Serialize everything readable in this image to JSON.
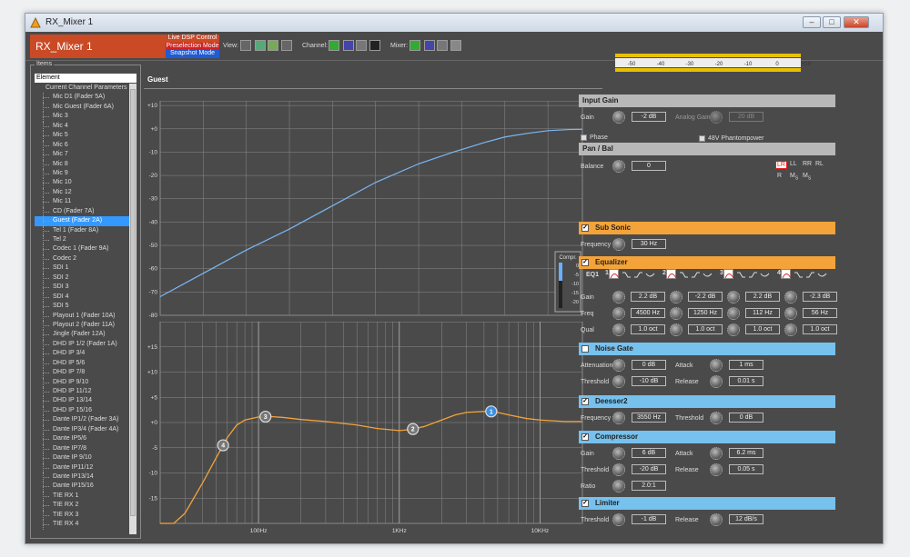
{
  "window": {
    "title": "RX_Mixer 1"
  },
  "toolbar": {
    "app_name": "RX_Mixer 1",
    "modes": [
      {
        "label": "Live DSP Control",
        "color": "#c94a25"
      },
      {
        "label": "Preselection Mode",
        "color": "#d31f1f"
      },
      {
        "label": "Snapshot Mode",
        "color": "#1f5bd3"
      }
    ],
    "view_label": "View:",
    "channel_label": "Channel:",
    "mixer_label": "Mixer:"
  },
  "items_panel": {
    "legend": "Items",
    "column_header": "Element",
    "items": [
      "Current Channel Parameters",
      "Mic      D1 (Fader 5A)",
      "Mic      Guest (Fader 6A)",
      "Mic 3",
      "Mic 4",
      "Mic 5",
      "Mic 6",
      "Mic 7",
      "Mic 8",
      "Mic 9",
      "Mic 10",
      "Mic 12",
      "Mic 11",
      "CD (Fader 7A)",
      "Guest (Fader 2A)",
      "Tel 1 (Fader 8A)",
      "Tel 2",
      "Codec 1 (Fader 9A)",
      "Codec 2",
      "SDI 1",
      "SDI 2",
      "SDI 3",
      "SDI 4",
      "SDI 5",
      "Playout 1 (Fader 10A)",
      "Playout 2 (Fader 11A)",
      "Jingle (Fader 12A)",
      "DHD IP  1/2 (Fader 1A)",
      "DHD IP  3/4",
      "DHD IP  5/6",
      "DHD IP  7/8",
      "DHD IP  9/10",
      "DHD IP  11/12",
      "DHD IP  13/14",
      "DHD IP  15/16",
      "Dante IP1/2 (Fader 3A)",
      "Dante IP3/4 (Fader 4A)",
      "Dante IP5/6",
      "Dante IP7/8",
      "Dante IP 9/10",
      "Dante IP11/12",
      "Dante IP13/14",
      "Dante IP15/16",
      "TIE RX 1",
      "TIE RX 2",
      "TIE RX 3",
      "TIE RX 4"
    ],
    "selected_index": 14
  },
  "channel_title": "Guest",
  "meter": {
    "ticks": [
      "-50",
      "-40",
      "-30",
      "-20",
      "-10",
      "0",
      "+10"
    ],
    "ovl_label": "OVL"
  },
  "dynamics_chart": {
    "x_ticks": [
      "-80",
      "-70",
      "-60",
      "-50",
      "-40",
      "-30",
      "-20",
      "-10",
      "+0",
      "+10"
    ],
    "y_ticks": [
      "+10",
      "+0",
      "-10",
      "-20",
      "-30",
      "-40",
      "-50",
      "-60",
      "-70",
      "-80"
    ],
    "compr_label": "Compr.",
    "compr_ticks": [
      "0",
      "-5",
      "-10",
      "-15",
      "-20"
    ]
  },
  "eq_chart": {
    "y_ticks": [
      "+15",
      "+10",
      "+5",
      "+0",
      "-5",
      "-10",
      "-15"
    ],
    "x_labels": [
      "100Hz",
      "1KHz",
      "10KHz"
    ],
    "band_markers": [
      "1",
      "2",
      "3",
      "4"
    ]
  },
  "chart_data": [
    {
      "type": "line",
      "title": "",
      "xlabel": "",
      "ylabel": "",
      "xlim": [
        -80,
        18
      ],
      "ylim": [
        -80,
        12
      ],
      "series": [
        {
          "values_x": [
            -80,
            -70,
            -60,
            -50,
            -40,
            -30,
            -20,
            -12,
            -5,
            0,
            5,
            10,
            15,
            18
          ],
          "values_y": [
            -72,
            -62,
            -52,
            -43,
            -33,
            -23,
            -15,
            -10,
            -6,
            -3.5,
            -2,
            -0.8,
            -0.3,
            -0.2
          ]
        }
      ]
    },
    {
      "type": "line",
      "title": "",
      "xlabel": "",
      "ylabel": "",
      "xlim": [
        20,
        20000
      ],
      "ylim": [
        -20,
        20
      ],
      "xscale": "log",
      "series": [
        {
          "values_x": [
            20,
            25,
            30,
            40,
            50,
            60,
            70,
            80,
            100,
            120,
            150,
            200,
            300,
            500,
            700,
            1000,
            1200,
            1500,
            2000,
            2500,
            3000,
            4000,
            4500,
            5000,
            6000,
            8000,
            10000,
            15000,
            20000
          ],
          "values_y": [
            -20,
            -20,
            -18,
            -12,
            -7,
            -3,
            -0.5,
            0.5,
            1.1,
            1.2,
            1,
            0.6,
            0.2,
            -0.5,
            -1.2,
            -1.6,
            -1.4,
            -0.8,
            0.5,
            1.5,
            2,
            2.2,
            2.2,
            2,
            1.5,
            0.8,
            0.5,
            0.2,
            0.2
          ]
        }
      ],
      "markers": [
        {
          "band": "1",
          "freq": 4500,
          "gain": 2.2
        },
        {
          "band": "2",
          "freq": 1250,
          "gain": -2.2
        },
        {
          "band": "3",
          "freq": 112,
          "gain": 2.2
        },
        {
          "band": "4",
          "freq": 56,
          "gain": -2.3
        }
      ]
    }
  ],
  "input_gain": {
    "title": "Input Gain",
    "gain_label": "Gain",
    "gain": "-2 dB",
    "analog_label": "Analog Gain",
    "analog": "20 dB",
    "phase_label": "Phase",
    "phantom_label": "48V Phantompower"
  },
  "pan_bal": {
    "title": "Pan / Bal",
    "balance_label": "Balance",
    "balance": "0",
    "modes_row1": [
      "LR",
      "LL",
      "RR",
      "RL"
    ],
    "modes_row2": [
      "R",
      "M",
      "M"
    ],
    "modes_row2_sub": [
      "",
      "S",
      "S"
    ]
  },
  "sub_sonic": {
    "title": "Sub Sonic",
    "freq_label": "Frequency",
    "freq": "30 Hz"
  },
  "equalizer": {
    "title": "Equalizer",
    "eq_label": "EQ1",
    "bands": [
      "1",
      "2",
      "3",
      "4"
    ],
    "gain_label": "Gain",
    "freq_label": "Freq",
    "qual_label": "Qual",
    "gains": [
      "2.2 dB",
      "-2.2 dB",
      "2.2 dB",
      "-2.3 dB"
    ],
    "freqs": [
      "4500 Hz",
      "1250 Hz",
      "112 Hz",
      "56 Hz"
    ],
    "quals": [
      "1.0 oct",
      "1.0 oct",
      "1.0 oct",
      "1.0 oct"
    ]
  },
  "noise_gate": {
    "title": "Noise Gate",
    "att_label": "Attenuation",
    "att": "0 dB",
    "thr_label": "Threshold",
    "thr": "-10 dB",
    "attack_label": "Attack",
    "attack": "1 ms",
    "release_label": "Release",
    "release": "0.01 s"
  },
  "deesser": {
    "title": "Deesser2",
    "freq_label": "Frequency",
    "freq": "3550 Hz",
    "thr_label": "Threshold",
    "thr": "0 dB"
  },
  "compressor": {
    "title": "Compressor",
    "gain_label": "Gain",
    "gain": "6 dB",
    "thr_label": "Threshold",
    "thr": "-20 dB",
    "ratio_label": "Ratio",
    "ratio": "2.0:1",
    "attack_label": "Attack",
    "attack": "6.2 ms",
    "release_label": "Release",
    "release": "0.05 s"
  },
  "limiter": {
    "title": "Limiter",
    "thr_label": "Threshold",
    "thr": "-1 dB",
    "release_label": "Release",
    "release": "12 dB/s"
  }
}
